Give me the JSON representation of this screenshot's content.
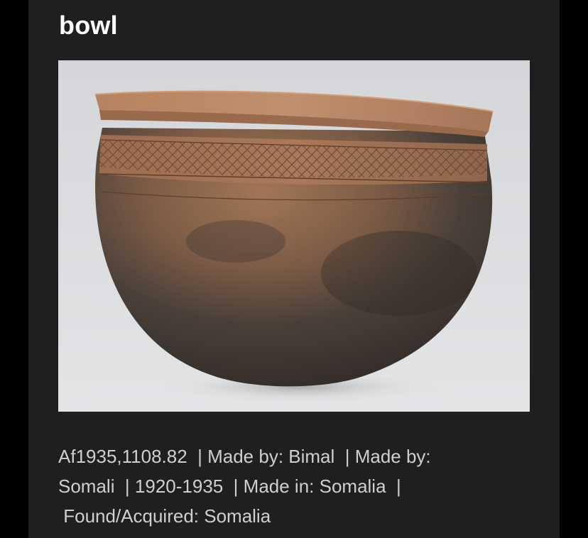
{
  "object": {
    "title": "bowl",
    "image_alt": "Image of terracotta bowl",
    "meta_line1": "Af1935,1108.82  | Made by: Bimal  | Made by:",
    "meta_line2": "Somali  | 1920-1935  | Made in: Somalia  |",
    "meta_line3": " Found/Acquired: Somalia"
  },
  "colors": {
    "page_background": "#000000",
    "card_background": "#1f1f1f",
    "title_text": "#ffffff",
    "meta_text": "#cfcfcf"
  }
}
